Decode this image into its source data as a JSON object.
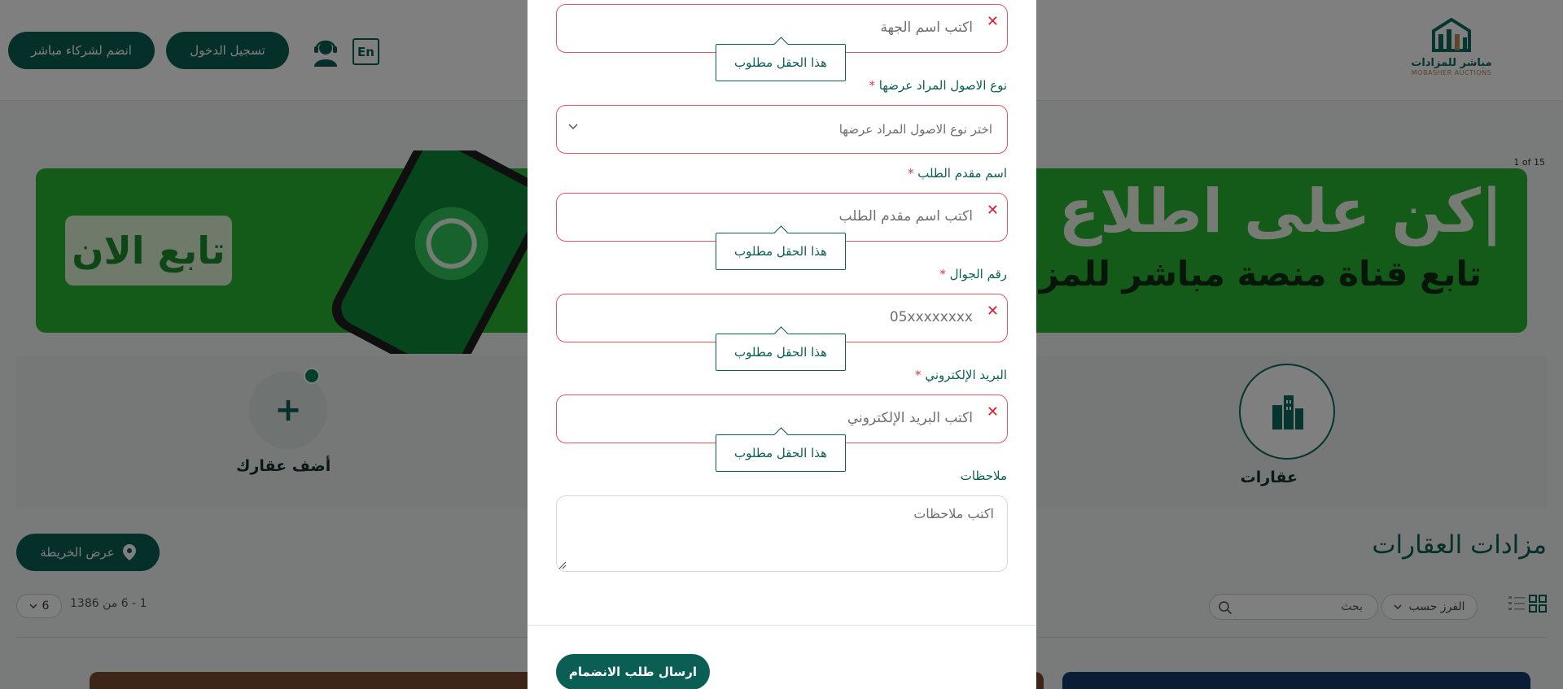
{
  "header": {
    "logo_text_ar": "مباشر للمزادات",
    "logo_text_en": "MOBASHER AUCTIONS",
    "join_partners_label": "انضم لشركاء مباشر",
    "login_label": "تسجيل الدخول",
    "language_label": "En",
    "icons": {
      "support": "headset-user-icon"
    }
  },
  "banner": {
    "slide_counter": "1 of 15",
    "headline": "|كن على اطلاع بكـ",
    "subline": "تابع قناة منصة مباشر للمزا",
    "cta_label": "تابع الان",
    "colors": {
      "background": "#29b531",
      "cta_text": "#1c8f2a"
    }
  },
  "categories": {
    "items": [
      {
        "label": "عقارات",
        "icon": "buildings-icon"
      },
      {
        "label": "أضف عقارك",
        "icon": "plus-icon"
      }
    ]
  },
  "listing": {
    "title": "مزادات العقارات",
    "map_button_label": "عرض الخريطة",
    "sort_label": "الفرز حسب",
    "search_placeholder": "بحث",
    "result_range": "1 - 6 من 1386",
    "page_size": "6",
    "icons": {
      "map": "map-pin-icon",
      "search": "search-icon",
      "grid": "grid-view-icon",
      "list": "list-view-icon"
    }
  },
  "modal": {
    "validation_message": "هذا الحقل مطلوب",
    "fields": {
      "entity_name": {
        "placeholder": "اكتب اسم الجهة"
      },
      "asset_type": {
        "label": "نوع الاصول المراد عرضها",
        "placeholder": "اختر نوع الاصول المراد عرضها"
      },
      "applicant_name": {
        "label": "اسم مقدم الطلب",
        "placeholder": "اكتب اسم مقدم الطلب"
      },
      "mobile": {
        "label": "رقم الجوال",
        "placeholder": "05xxxxxxxx"
      },
      "email": {
        "label": "البريد الإلكتروني",
        "placeholder": "اكتب البريد الإلكتروني"
      },
      "notes": {
        "label": "ملاحظات",
        "placeholder": "اكتب ملاحظات"
      }
    },
    "required_mark": "*",
    "submit_label": "ارسال طلب الانضمام",
    "colors": {
      "primary": "#0b5e53",
      "error": "#e35461"
    }
  }
}
